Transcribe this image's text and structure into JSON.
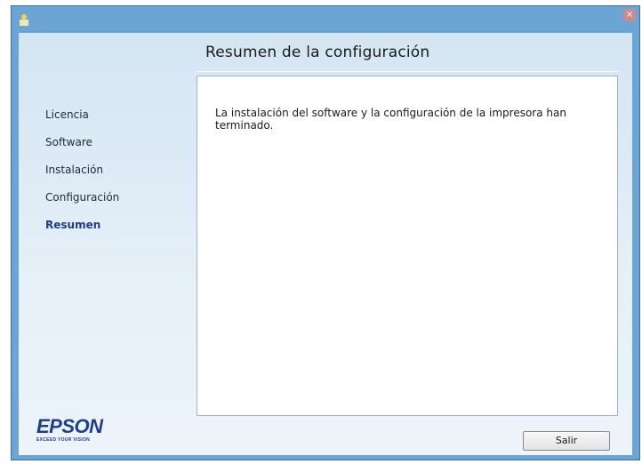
{
  "window": {
    "close_glyph": "×",
    "app_icon": "installer-icon"
  },
  "page": {
    "title": "Resumen de la configuración"
  },
  "nav": {
    "items": [
      {
        "label": "Licencia",
        "active": false
      },
      {
        "label": "Software",
        "active": false
      },
      {
        "label": "Instalación",
        "active": false
      },
      {
        "label": "Configuración",
        "active": false
      },
      {
        "label": "Resumen",
        "active": true
      }
    ]
  },
  "content": {
    "message": "La instalación del software y la configuración de la impresora han terminado."
  },
  "logo": {
    "brand": "EPSON",
    "tagline": "EXCEED YOUR VISION"
  },
  "footer": {
    "exit_label": "Salir"
  },
  "colors": {
    "accent": "#1c3e8a",
    "frame": "#6aa5d6"
  }
}
